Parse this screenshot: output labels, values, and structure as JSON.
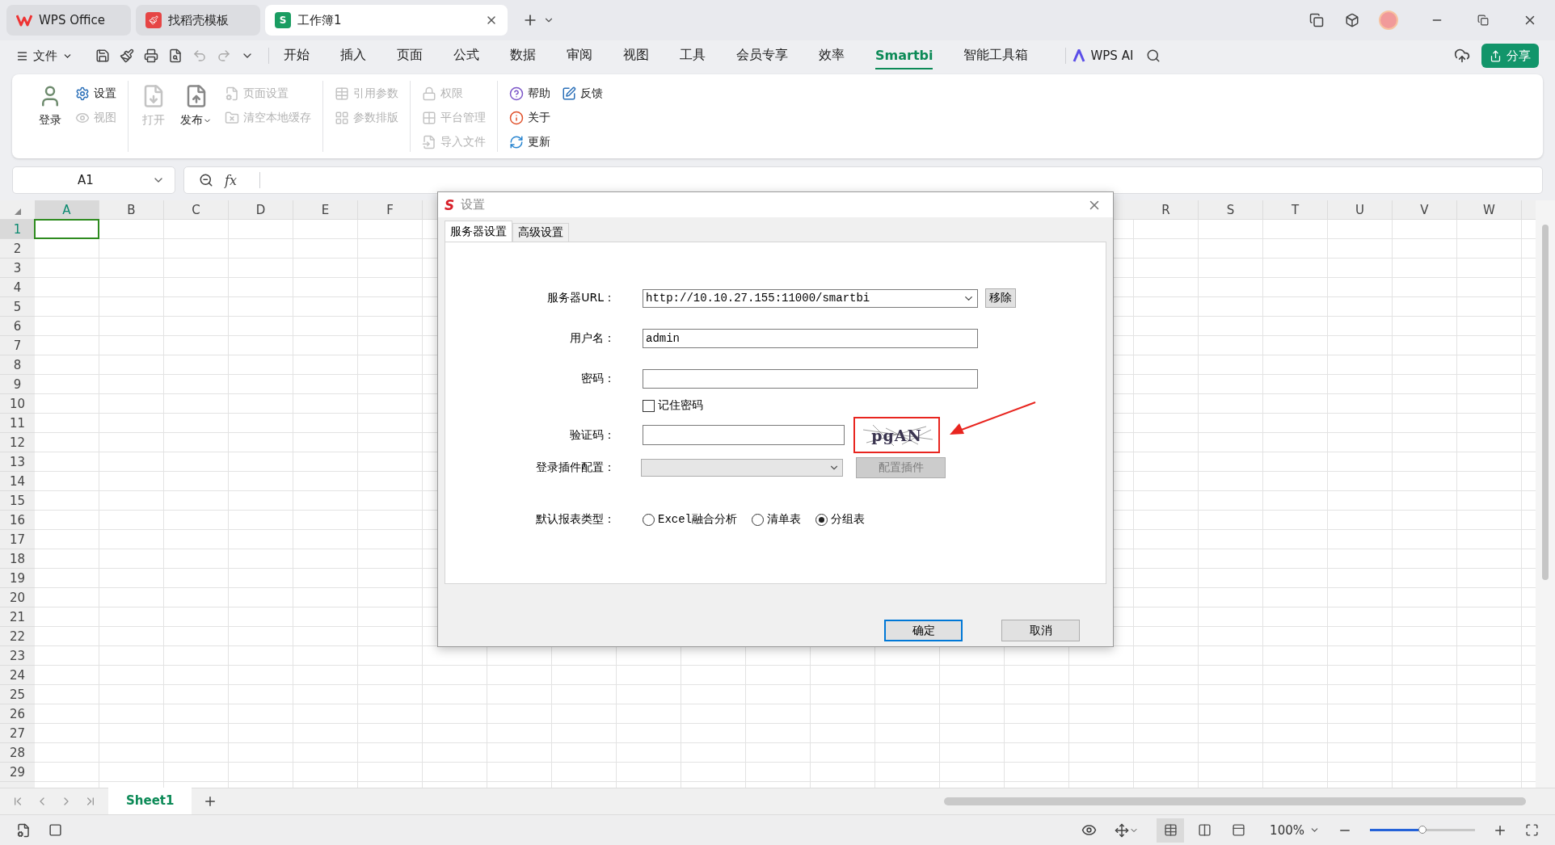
{
  "tabs": [
    {
      "label": "WPS Office",
      "kind": "wps",
      "selected": false
    },
    {
      "label": "找稻壳模板",
      "kind": "docer",
      "selected": false
    },
    {
      "label": "工作簿1",
      "kind": "sheet",
      "selected": true,
      "icon_text": "S"
    }
  ],
  "menu": {
    "file": "文件",
    "items": [
      {
        "label": "开始",
        "selected": false
      },
      {
        "label": "插入",
        "selected": false
      },
      {
        "label": "页面",
        "selected": false
      },
      {
        "label": "公式",
        "selected": false
      },
      {
        "label": "数据",
        "selected": false
      },
      {
        "label": "审阅",
        "selected": false
      },
      {
        "label": "视图",
        "selected": false
      },
      {
        "label": "工具",
        "selected": false
      },
      {
        "label": "会员专享",
        "selected": false
      },
      {
        "label": "效率",
        "selected": false
      },
      {
        "label": "Smartbi",
        "selected": true
      },
      {
        "label": "智能工具箱",
        "selected": false
      }
    ],
    "ai": "WPS AI",
    "share": "分享"
  },
  "ribbon": [
    {
      "columns": [
        {
          "kind": "large",
          "items": [
            {
              "label": "登录",
              "kind": "login",
              "disabled": false
            }
          ]
        },
        {
          "kind": "stack",
          "items": [
            {
              "label": "设置",
              "kind": "settings",
              "disabled": false
            },
            {
              "label": "视图",
              "kind": "view",
              "disabled": true
            }
          ]
        }
      ]
    },
    {
      "columns": [
        {
          "kind": "large",
          "items": [
            {
              "label": "打开",
              "kind": "open",
              "disabled": true
            }
          ]
        },
        {
          "kind": "large",
          "items": [
            {
              "label": "发布",
              "kind": "publish",
              "disabled": false,
              "caret": true
            }
          ]
        },
        {
          "kind": "stack",
          "items": [
            {
              "label": "页面设置",
              "kind": "page",
              "disabled": true
            },
            {
              "label": "清空本地缓存",
              "kind": "clear",
              "disabled": true
            }
          ]
        }
      ]
    },
    {
      "columns": [
        {
          "kind": "stack",
          "items": [
            {
              "label": "引用参数",
              "kind": "param",
              "disabled": true
            },
            {
              "label": "参数排版",
              "kind": "layout",
              "disabled": true
            }
          ]
        }
      ]
    },
    {
      "columns": [
        {
          "kind": "stack",
          "items": [
            {
              "label": "权限",
              "kind": "permission",
              "disabled": true
            },
            {
              "label": "平台管理",
              "kind": "platform",
              "disabled": true
            },
            {
              "label": "导入文件",
              "kind": "import",
              "disabled": true
            }
          ]
        }
      ]
    },
    {
      "columns": [
        {
          "kind": "stack",
          "items": [
            {
              "label": "帮助",
              "kind": "help",
              "disabled": false
            },
            {
              "label": "关于",
              "kind": "about",
              "disabled": false
            },
            {
              "label": "更新",
              "kind": "update",
              "disabled": false
            }
          ]
        },
        {
          "kind": "stack",
          "items": [
            {
              "label": "反馈",
              "kind": "feedback",
              "disabled": false
            }
          ]
        }
      ]
    }
  ],
  "formula_bar": {
    "cell": "A1",
    "fx": "fx"
  },
  "sheet": {
    "columns_left": [
      {
        "label": "A",
        "selected": true
      },
      {
        "label": "B",
        "selected": false
      },
      {
        "label": "C",
        "selected": false
      },
      {
        "label": "D",
        "selected": false
      },
      {
        "label": "E",
        "selected": false
      },
      {
        "label": "F",
        "selected": false
      }
    ],
    "columns_right": [
      {
        "label": "R",
        "selected": false
      },
      {
        "label": "S",
        "selected": false
      },
      {
        "label": "T",
        "selected": false
      },
      {
        "label": "U",
        "selected": false
      },
      {
        "label": "V",
        "selected": false
      },
      {
        "label": "W",
        "selected": false
      }
    ],
    "rows": [
      {
        "label": "1",
        "selected": true
      },
      {
        "label": "2",
        "selected": false
      },
      {
        "label": "3",
        "selected": false
      },
      {
        "label": "4",
        "selected": false
      },
      {
        "label": "5",
        "selected": false
      },
      {
        "label": "6",
        "selected": false
      },
      {
        "label": "7",
        "selected": false
      },
      {
        "label": "8",
        "selected": false
      },
      {
        "label": "9",
        "selected": false
      },
      {
        "label": "10",
        "selected": false
      },
      {
        "label": "11",
        "selected": false
      },
      {
        "label": "12",
        "selected": false
      },
      {
        "label": "13",
        "selected": false
      },
      {
        "label": "14",
        "selected": false
      },
      {
        "label": "15",
        "selected": false
      },
      {
        "label": "16",
        "selected": false
      },
      {
        "label": "17",
        "selected": false
      },
      {
        "label": "18",
        "selected": false
      },
      {
        "label": "19",
        "selected": false
      },
      {
        "label": "20",
        "selected": false
      },
      {
        "label": "21",
        "selected": false
      },
      {
        "label": "22",
        "selected": false
      },
      {
        "label": "23",
        "selected": false
      },
      {
        "label": "24",
        "selected": false
      },
      {
        "label": "25",
        "selected": false
      },
      {
        "label": "26",
        "selected": false
      },
      {
        "label": "27",
        "selected": false
      },
      {
        "label": "28",
        "selected": false
      },
      {
        "label": "29",
        "selected": false
      }
    ]
  },
  "dialog": {
    "logo": "S",
    "title": "设置",
    "tabs": [
      {
        "label": "服务器设置",
        "selected": true
      },
      {
        "label": "高级设置",
        "selected": false
      }
    ],
    "server_url": {
      "label": "服务器URL：",
      "value": "http://10.10.27.155:11000/smartbi",
      "button": "移除"
    },
    "username": {
      "label": "用户名：",
      "value": "admin"
    },
    "password": {
      "label": "密码："
    },
    "remember": {
      "label": "记住密码",
      "checked": false
    },
    "captcha": {
      "label": "验证码：",
      "image_text": "pgAN"
    },
    "plugin": {
      "label": "登录插件配置：",
      "button": "配置插件",
      "disabled": true
    },
    "report_type": {
      "label": "默认报表类型：",
      "options": [
        {
          "label": "Excel融合分析",
          "selected": false
        },
        {
          "label": "清单表",
          "selected": false
        },
        {
          "label": "分组表",
          "selected": true
        }
      ]
    },
    "buttons": [
      {
        "label": "确定",
        "kind": "primary"
      },
      {
        "label": "取消",
        "kind": "default"
      }
    ]
  },
  "sheet_tabs": [
    {
      "label": "Sheet1",
      "selected": true
    }
  ],
  "status": {
    "views": [
      {
        "kind": "normal",
        "selected": true
      },
      {
        "kind": "split",
        "selected": false
      },
      {
        "kind": "page",
        "selected": false
      }
    ],
    "zoom": "100%",
    "level": 0.5
  }
}
